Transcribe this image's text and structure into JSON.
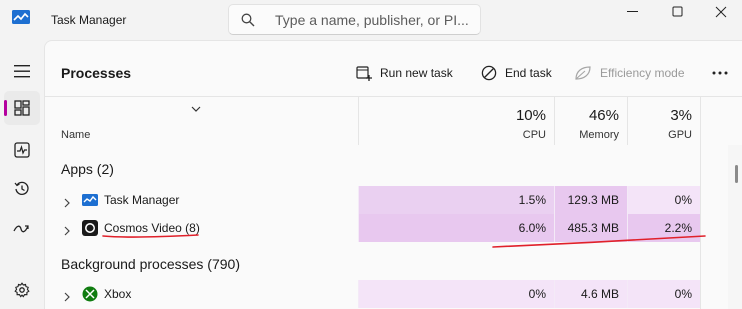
{
  "window": {
    "title": "Task Manager",
    "search_placeholder": "Type a name, publisher, or PI..."
  },
  "nav": {
    "items": [
      {
        "icon": "hamburger-icon"
      },
      {
        "icon": "processes-icon",
        "active": true
      },
      {
        "icon": "performance-icon"
      },
      {
        "icon": "app-history-icon"
      },
      {
        "icon": "startup-apps-icon"
      },
      {
        "icon": "settings-icon"
      }
    ]
  },
  "toolbar": {
    "page_title": "Processes",
    "run_new_task": "Run new task",
    "end_task": "End task",
    "efficiency_mode": "Efficiency mode",
    "more": "..."
  },
  "columns": {
    "name": "Name",
    "cpu": {
      "percent": "10%",
      "label": "CPU"
    },
    "memory": {
      "percent": "46%",
      "label": "Memory"
    },
    "gpu": {
      "percent": "3%",
      "label": "GPU"
    }
  },
  "sections": {
    "apps": "Apps (2)",
    "background": "Background processes (790)"
  },
  "rows": [
    {
      "name": "Task Manager",
      "cpu": "1.5%",
      "memory": "129.3 MB",
      "gpu": "0%",
      "icon": "task-manager-icon"
    },
    {
      "name": "Cosmos Video (8)",
      "cpu": "6.0%",
      "memory": "485.3 MB",
      "gpu": "2.2%",
      "icon": "cosmos-video-icon"
    },
    {
      "name": "Xbox",
      "cpu": "0%",
      "memory": "4.6 MB",
      "gpu": "0%",
      "icon": "xbox-icon"
    }
  ],
  "colors": {
    "accent": "#b4009e",
    "heat_strong": "#e8c8ef",
    "heat_light": "#f4e4f8",
    "annotation": "#e0202a"
  }
}
